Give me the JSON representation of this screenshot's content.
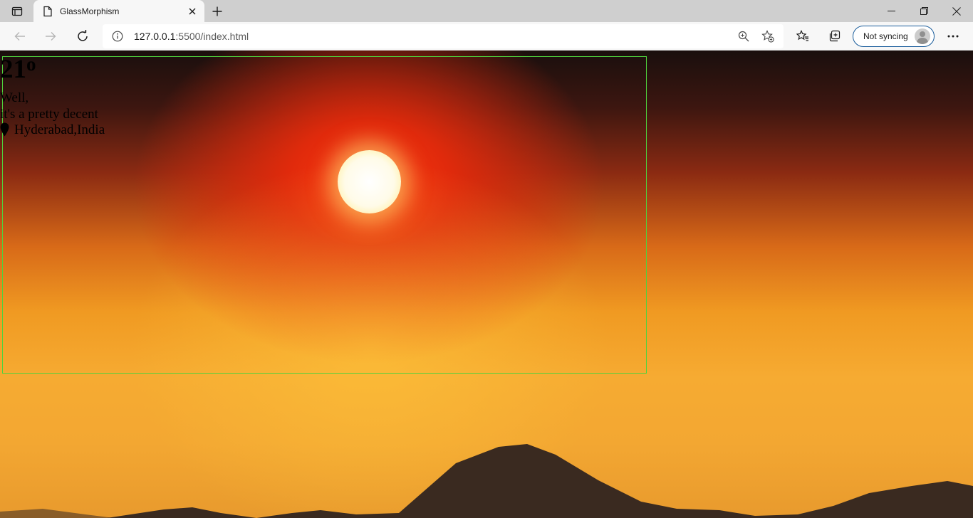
{
  "browser": {
    "tab": {
      "title": "GlassMorphism"
    },
    "address": {
      "host": "127.0.0.1",
      "path": ":5500/index.html"
    },
    "profile": {
      "label": "Not syncing"
    },
    "icons": {
      "tab_actions": "tab-actions-icon",
      "page": "document-icon",
      "close_tab": "close-icon",
      "new_tab": "plus-icon",
      "back": "arrow-left-icon",
      "forward": "arrow-right-icon",
      "refresh": "refresh-icon",
      "site_info": "info-icon",
      "zoom": "zoom-icon",
      "add_favorite": "star-add-icon",
      "favorites": "favorites-icon",
      "collections": "collections-icon",
      "more": "ellipsis-icon",
      "minimize": "minimize-icon",
      "maximize": "restore-icon",
      "close_window": "close-icon"
    }
  },
  "weather": {
    "temperature": "21",
    "degree": "o",
    "line1": "Well,",
    "line2": "it's a pretty decent",
    "location": "Hyderabad,India"
  },
  "colors": {
    "card_border": "#4fd23d",
    "profile_border": "#1a5d9c",
    "tabstrip": "#cfcfcf",
    "toolbar": "#f7f7f7"
  }
}
